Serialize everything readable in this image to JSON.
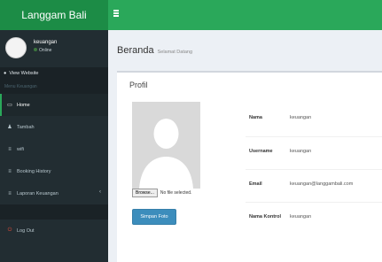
{
  "app": {
    "title": "Langgam Bali"
  },
  "user": {
    "name": "keuangan",
    "status": "Online"
  },
  "sidebar": {
    "view_website": "View Website",
    "menu_header": "Menu Keuangan",
    "items": [
      {
        "label": "Home",
        "icon": "monitor-icon",
        "active": true
      },
      {
        "label": "Tambah",
        "icon": "user-icon"
      },
      {
        "label": "wifi",
        "icon": "list-icon"
      },
      {
        "label": "Booking History",
        "icon": "list-icon"
      },
      {
        "label": "Laporan Keuangan",
        "icon": "list-icon"
      },
      {
        "label": "Log Out",
        "icon": "power-icon"
      }
    ]
  },
  "page": {
    "title": "Beranda",
    "subtitle": "Selamat Datang"
  },
  "profile": {
    "title": "Profil",
    "file_button": "Browse...",
    "file_status": "No file selected.",
    "upload_button": "Simpan Foto",
    "fields": [
      {
        "label": "Nama",
        "value": "keuangan"
      },
      {
        "label": "Username",
        "value": "keuangan"
      },
      {
        "label": "Email",
        "value": "keuangan@langgambali.com"
      },
      {
        "label": "Nama Kontrol",
        "value": "keuangan"
      }
    ]
  },
  "colors": {
    "header_green": "#2aa85a",
    "logo_green": "#1c8c46",
    "sidebar_bg": "#222d32",
    "button_blue": "#3c8dbc",
    "logout_red": "#dd4b39"
  }
}
